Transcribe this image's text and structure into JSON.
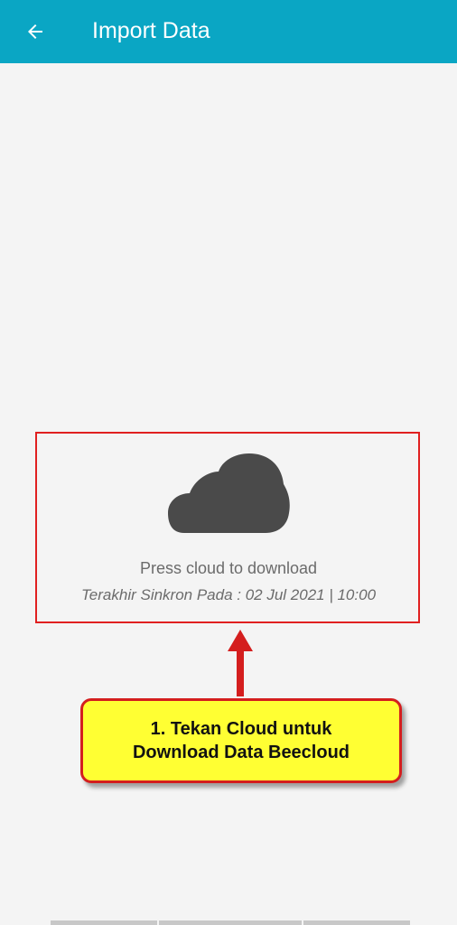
{
  "appbar": {
    "title": "Import Data",
    "back_icon": "arrow-left-icon",
    "color": "#0aa6c4"
  },
  "main": {
    "cloud_icon": "cloud-icon",
    "press_text": "Press cloud to download",
    "last_sync_text": "Terakhir Sinkron Pada : 02 Jul 2021 | 10:00"
  },
  "annotation": {
    "callout_line1": "1. Tekan Cloud untuk",
    "callout_line2": "Download Data Beecloud",
    "highlight_color": "#e02020",
    "callout_bg": "#ffff33"
  }
}
